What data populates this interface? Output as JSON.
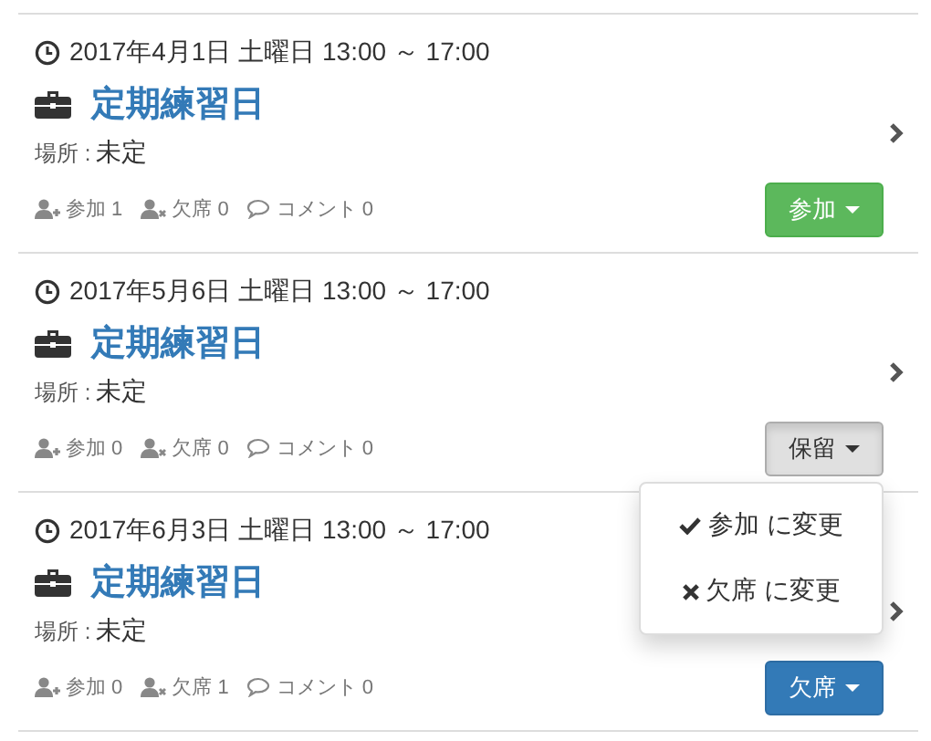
{
  "events": [
    {
      "datetime": "2017年4月1日 土曜日 13:00 ～ 17:00",
      "title": "定期練習日",
      "place_label": "場所 :",
      "place": "未定",
      "attend": "参加 1",
      "absent": "欠席 0",
      "comments": "コメント 0",
      "response": {
        "kind": "join",
        "label": "参加",
        "expanded": false
      }
    },
    {
      "datetime": "2017年5月6日 土曜日 13:00 ～ 17:00",
      "title": "定期練習日",
      "place_label": "場所 :",
      "place": "未定",
      "attend": "参加 0",
      "absent": "欠席 0",
      "comments": "コメント 0",
      "response": {
        "kind": "hold",
        "label": "保留",
        "expanded": true
      },
      "menu": [
        {
          "kind": "join",
          "label": "参加 に変更"
        },
        {
          "kind": "absent",
          "label": "欠席 に変更"
        }
      ]
    },
    {
      "datetime": "2017年6月3日 土曜日 13:00 ～ 17:00",
      "title": "定期練習日",
      "place_label": "場所 :",
      "place": "未定",
      "attend": "参加 0",
      "absent": "欠席 1",
      "comments": "コメント 0",
      "response": {
        "kind": "absent",
        "label": "欠席",
        "expanded": false
      }
    }
  ]
}
